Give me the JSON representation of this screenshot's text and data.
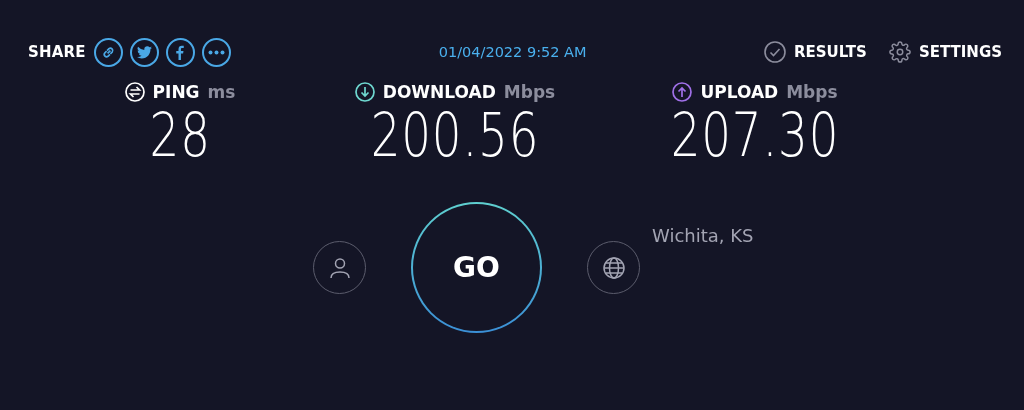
{
  "header": {
    "share_label": "SHARE",
    "datetime": "01/04/2022 9:52 AM",
    "links": [
      {
        "kind": "results",
        "label": "RESULTS"
      },
      {
        "kind": "settings",
        "label": "SETTINGS"
      }
    ]
  },
  "share_icons": [
    {
      "kind": "link"
    },
    {
      "kind": "twitter"
    },
    {
      "kind": "facebook"
    },
    {
      "kind": "more"
    }
  ],
  "metrics": [
    {
      "kind": "ping",
      "label": "PING",
      "unit": "ms",
      "value": "28",
      "color": "#ffffff"
    },
    {
      "kind": "download",
      "label": "DOWNLOAD",
      "unit": "Mbps",
      "value": "200.56",
      "color": "#6fd8d0"
    },
    {
      "kind": "upload",
      "label": "UPLOAD",
      "unit": "Mbps",
      "value": "207.30",
      "color": "#a070e8"
    }
  ],
  "go_button": {
    "label": "GO"
  },
  "server": {
    "location": "Wichita, KS"
  }
}
